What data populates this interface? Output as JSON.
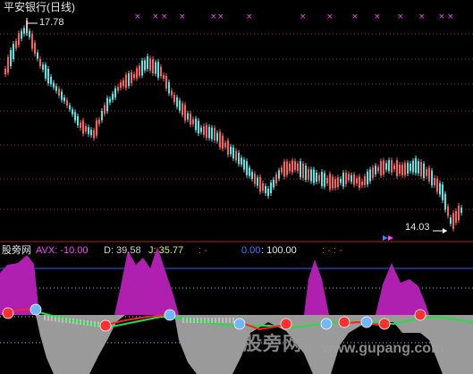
{
  "top_panel": {
    "title": "平安银行(日线)",
    "high_label": "17.78",
    "low_label": "14.03",
    "colors": {
      "up": "#ff5c5c",
      "down": "#4fe8e8",
      "grid": "#a52a2a",
      "markers": "#ff44ff"
    }
  },
  "bottom_panel": {
    "name": "股旁网",
    "avx": "AVX: -10.00",
    "d": "D: 39.58",
    "j": "J: 35.77",
    "dash1": ": -",
    "zero": "0.00",
    "hundred": ": 100.00",
    "dash2": ": - : -",
    "colors": {
      "fill_magenta": "#b020b0",
      "fill_gray": "#9a9a9a",
      "line_red": "#ff2020",
      "line_green": "#20e040",
      "ball_blue": "#6fb8ff",
      "ball_red": "#ff3030",
      "level_line": "#2060ff"
    }
  },
  "watermark": {
    "text": "股旁网",
    "url": "www.gupang.com"
  }
}
